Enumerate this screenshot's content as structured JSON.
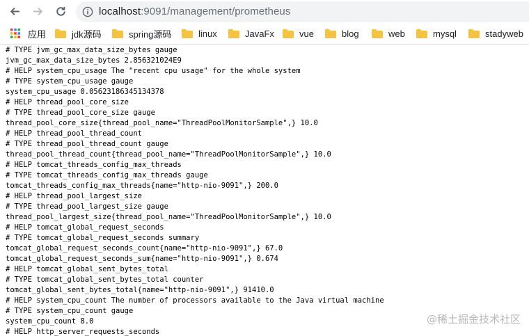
{
  "toolbar": {
    "url_host": "localhost",
    "url_rest": ":9091/management/prometheus"
  },
  "bookmarks": [
    {
      "label": "应用",
      "icon": "apps-grid-icon"
    },
    {
      "label": "jdk源码",
      "icon": "folder-icon"
    },
    {
      "label": "spring源码",
      "icon": "folder-icon"
    },
    {
      "label": "linux",
      "icon": "folder-icon"
    },
    {
      "label": "JavaFx",
      "icon": "folder-icon"
    },
    {
      "label": "vue",
      "icon": "folder-icon"
    },
    {
      "label": "blog",
      "icon": "folder-icon"
    },
    {
      "label": "web",
      "icon": "folder-icon"
    },
    {
      "label": "mysql",
      "icon": "folder-icon"
    },
    {
      "label": "stadyweb",
      "icon": "folder-icon"
    }
  ],
  "content": {
    "lines": [
      "# TYPE jvm_gc_max_data_size_bytes gauge",
      "jvm_gc_max_data_size_bytes 2.856321024E9",
      "# HELP system_cpu_usage The \"recent cpu usage\" for the whole system",
      "# TYPE system_cpu_usage gauge",
      "system_cpu_usage 0.05623186345134378",
      "# HELP thread_pool_core_size",
      "# TYPE thread_pool_core_size gauge",
      "thread_pool_core_size{thread_pool_name=\"ThreadPoolMonitorSample\",} 10.0",
      "# HELP thread_pool_thread_count",
      "# TYPE thread_pool_thread_count gauge",
      "thread_pool_thread_count{thread_pool_name=\"ThreadPoolMonitorSample\",} 10.0",
      "# HELP tomcat_threads_config_max_threads",
      "# TYPE tomcat_threads_config_max_threads gauge",
      "tomcat_threads_config_max_threads{name=\"http-nio-9091\",} 200.0",
      "# HELP thread_pool_largest_size",
      "# TYPE thread_pool_largest_size gauge",
      "thread_pool_largest_size{thread_pool_name=\"ThreadPoolMonitorSample\",} 10.0",
      "# HELP tomcat_global_request_seconds",
      "# TYPE tomcat_global_request_seconds summary",
      "tomcat_global_request_seconds_count{name=\"http-nio-9091\",} 67.0",
      "tomcat_global_request_seconds_sum{name=\"http-nio-9091\",} 0.674",
      "# HELP tomcat_global_sent_bytes_total",
      "# TYPE tomcat_global_sent_bytes_total counter",
      "tomcat_global_sent_bytes_total{name=\"http-nio-9091\",} 91410.0",
      "# HELP system_cpu_count The number of processors available to the Java virtual machine",
      "# TYPE system_cpu_count gauge",
      "system_cpu_count 8.0",
      "# HELP http_server_requests_seconds"
    ]
  },
  "watermark": "@稀土掘金技术社区",
  "colors": {
    "folder": "#f5c342",
    "omnibox_bg": "#f1f3f4",
    "icon_gray": "#5f6368"
  }
}
